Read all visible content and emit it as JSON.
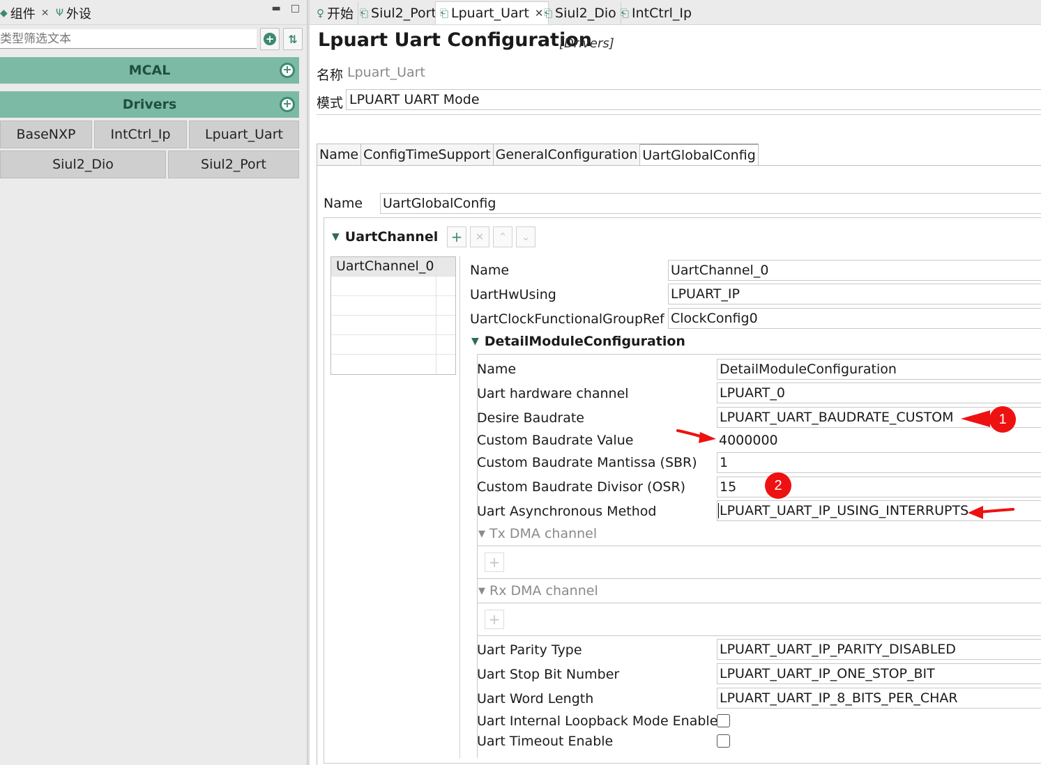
{
  "left_panel": {
    "tabs": [
      {
        "label": "组件",
        "icon": "component-icon",
        "closable": true
      },
      {
        "label": "外设",
        "icon": "usb-icon",
        "closable": false
      }
    ],
    "filter_placeholder": "类型筛选文本",
    "groups": [
      {
        "label": "MCAL"
      },
      {
        "label": "Drivers"
      }
    ],
    "modules_row1": [
      "BaseNXP",
      "IntCtrl_Ip",
      "Lpuart_Uart"
    ],
    "modules_row2": [
      "Siul2_Dio",
      "Siul2_Port"
    ]
  },
  "editor_tabs": [
    {
      "label": "开始",
      "icon": "lightbulb-icon",
      "active": false
    },
    {
      "label": "Siul2_Port",
      "icon": "module-icon",
      "active": false
    },
    {
      "label": "Lpuart_Uart",
      "icon": "module-icon",
      "active": true
    },
    {
      "label": "Siul2_Dio",
      "icon": "module-icon",
      "active": false
    },
    {
      "label": "IntCtrl_Ip",
      "icon": "module-icon",
      "active": false
    }
  ],
  "editor": {
    "title": "Lpuart Uart Configuration",
    "subtitle": "[Drivers]",
    "name_label": "名称",
    "name_value": "Lpuart_Uart",
    "mode_label": "模式",
    "mode_value": "LPUART UART Mode",
    "config_tabs": [
      "Name",
      "ConfigTimeSupport",
      "GeneralConfiguration",
      "UartGlobalConfig"
    ],
    "global": {
      "name_label": "Name",
      "name_value": "UartGlobalConfig"
    },
    "uart_channel": {
      "header": "UartChannel",
      "channels": [
        "UartChannel_0"
      ],
      "fields": {
        "name_label": "Name",
        "name_value": "UartChannel_0",
        "hw_label": "UartHwUsing",
        "hw_value": "LPUART_IP",
        "clock_label": "UartClockFunctionalGroupRef",
        "clock_value": "ClockConfig0"
      }
    },
    "detail": {
      "header": "DetailModuleConfiguration",
      "rows": [
        {
          "label": "Name",
          "value": "DetailModuleConfiguration"
        },
        {
          "label": "Uart hardware channel",
          "value": "LPUART_0"
        },
        {
          "label": "Desire Baudrate",
          "value": "LPUART_UART_BAUDRATE_CUSTOM"
        },
        {
          "label": "Custom Baudrate Value",
          "value": "4000000"
        },
        {
          "label": "Custom Baudrate Mantissa (SBR)",
          "value": "1"
        },
        {
          "label": "Custom Baudrate Divisor (OSR)",
          "value": "15"
        },
        {
          "label": "Uart Asynchronous Method",
          "value": "LPUART_UART_IP_USING_INTERRUPTS"
        }
      ],
      "tx_dma": "Tx DMA channel",
      "rx_dma": "Rx DMA channel",
      "rows2": [
        {
          "label": "Uart Parity Type",
          "value": "LPUART_UART_IP_PARITY_DISABLED"
        },
        {
          "label": "Uart Stop Bit Number",
          "value": "LPUART_UART_IP_ONE_STOP_BIT"
        },
        {
          "label": "Uart Word Length",
          "value": "LPUART_UART_IP_8_BITS_PER_CHAR"
        }
      ],
      "checks": [
        {
          "label": "Uart Internal Loopback Mode Enable",
          "checked": false
        },
        {
          "label": "Uart Timeout Enable",
          "checked": false
        }
      ]
    }
  },
  "annotations": {
    "badge1": "1",
    "badge2": "2",
    "color": "#ee1111"
  }
}
